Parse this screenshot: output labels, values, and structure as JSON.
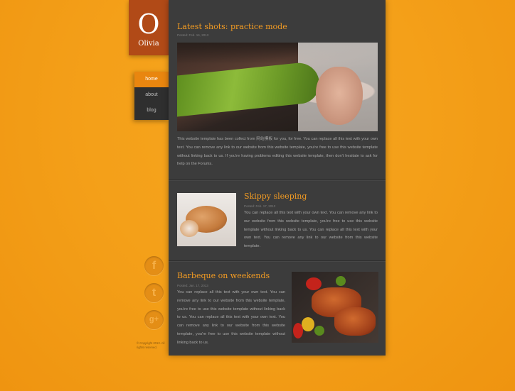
{
  "logo": {
    "letter": "O",
    "name": "Olivia"
  },
  "nav": {
    "items": [
      {
        "label": "home",
        "active": true
      },
      {
        "label": "about",
        "active": false
      },
      {
        "label": "blog",
        "active": false
      }
    ]
  },
  "posts": [
    {
      "title": "Latest shots: practice mode",
      "meta": "Posted: Feb. 16, 2013",
      "text": "This website template has been collect from 网站模板 for you, for free. You can replace all this text with your own text. You can remove any link to our website from this website template, you're free to use this website template without linking back to us. If you're having problems editing this website template, then don't hesitate to ask for help on the Forums."
    },
    {
      "title": "Skippy sleeping",
      "meta": "Posted: Feb. 17, 2013",
      "text": "You can replace all this text with your own text. You can remove any link to our website from this website template, you're free to use this website template without linking back to us. You can replace all this text with your own text. You can remove any link to our website from this website template."
    },
    {
      "title": "Barbeque on weekends",
      "meta": "Posted: Jan. 17, 2013",
      "text": "You can replace all this text with your own text. You can remove any link to our website from this website template, you're free to use this website template without linking back to us. You can replace all this text with your own text. You can remove any link to our website from this website template, you're free to use this website template without linking back to us."
    }
  ],
  "social": [
    {
      "name": "facebook",
      "glyph": "f"
    },
    {
      "name": "twitter",
      "glyph": "t"
    },
    {
      "name": "google-plus",
      "glyph": "g+"
    }
  ],
  "footer": {
    "copyright": "© Copyright 2013. All rights reserved."
  },
  "colors": {
    "accent": "#f29b23",
    "background": "#f4a019",
    "panel": "#3c3c3c",
    "logo": "#b14a17"
  }
}
